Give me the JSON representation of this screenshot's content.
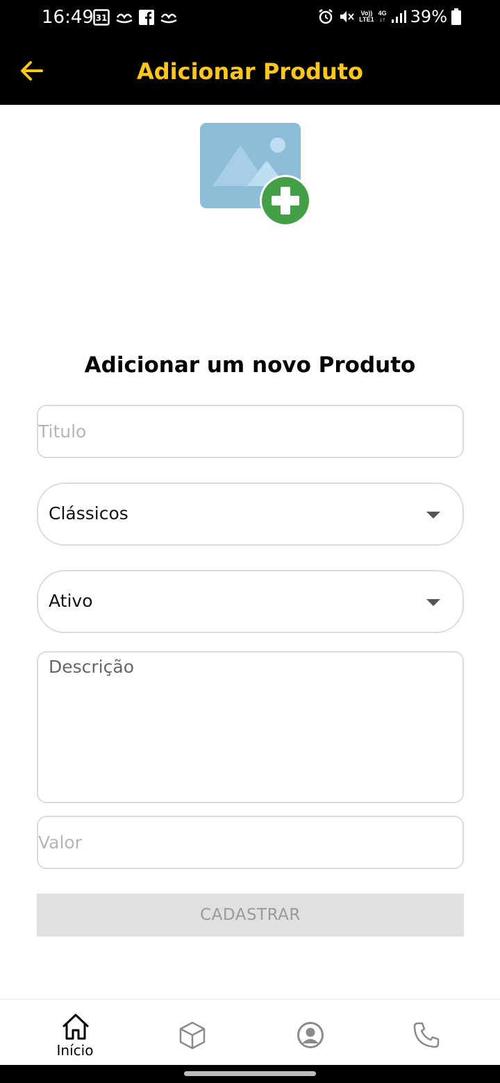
{
  "status_bar": {
    "time": "16:49",
    "calendar_day": "31",
    "network_volte": "Vo))",
    "network_lte": "LTE1",
    "network_type": "4G",
    "battery": "39%"
  },
  "app_bar": {
    "title": "Adicionar Produto",
    "accent_color": "#FFC61A"
  },
  "form": {
    "heading": "Adicionar um novo Produto",
    "title_placeholder": "Titulo",
    "category_selected": "Clássicos",
    "status_selected": "Ativo",
    "description_placeholder": "Descrição",
    "value_placeholder": "Valor",
    "submit_label": "CADASTRAR"
  },
  "bottom_nav": {
    "items": [
      {
        "icon": "home-icon",
        "label": "Início",
        "active": true
      },
      {
        "icon": "box-icon",
        "label": "",
        "active": false
      },
      {
        "icon": "user-icon",
        "label": "",
        "active": false
      },
      {
        "icon": "phone-icon",
        "label": "",
        "active": false
      }
    ]
  }
}
